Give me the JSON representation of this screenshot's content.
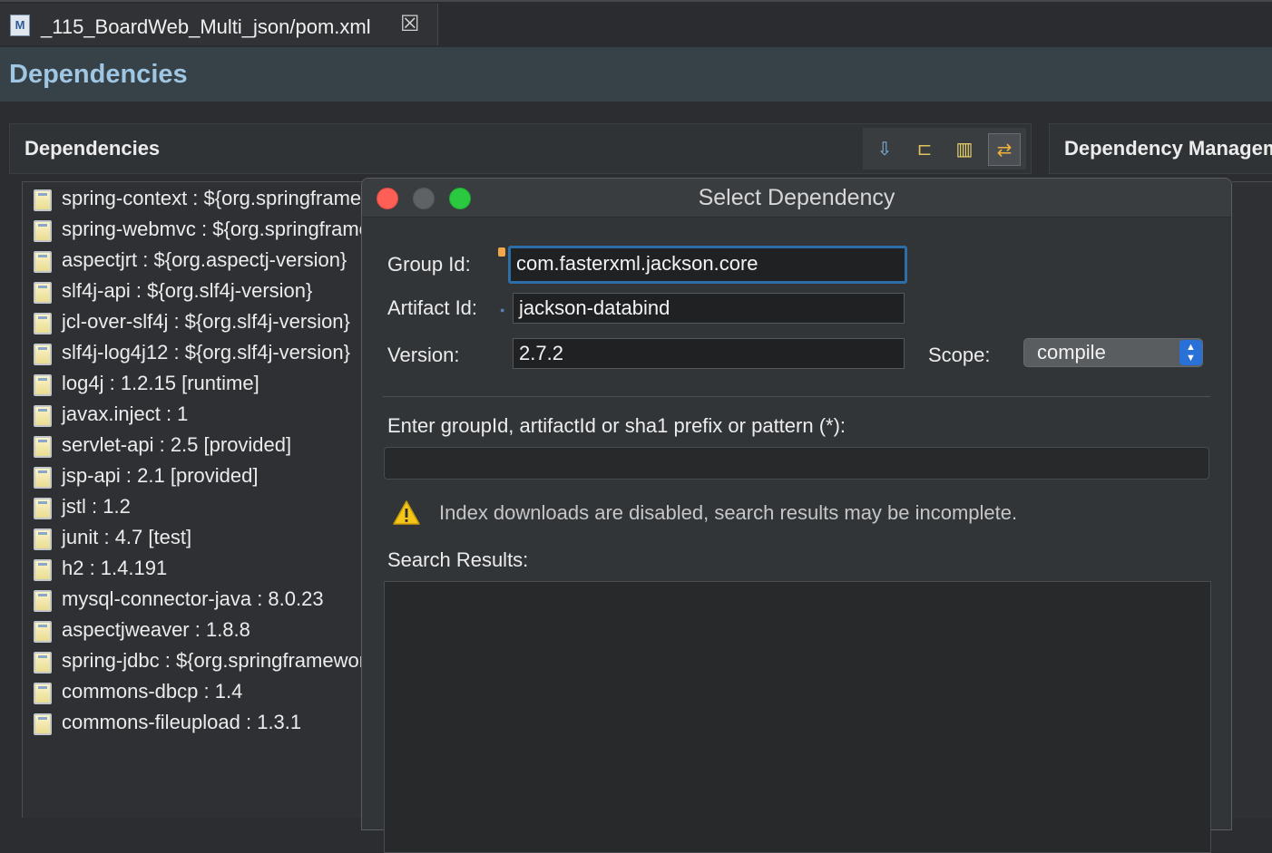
{
  "tab": {
    "title": "_115_BoardWeb_Multi_json/pom.xml",
    "icon": "maven-file-icon",
    "close_icon": "close-icon",
    "close_glyph": "☒"
  },
  "page": {
    "title": "Dependencies"
  },
  "dependencies_section": {
    "title": "Dependencies",
    "toolbar": [
      {
        "icon": "add-dependency-icon",
        "glyph": "⇩"
      },
      {
        "icon": "hierarchy-icon",
        "glyph": "⊏"
      },
      {
        "icon": "columns-icon",
        "glyph": "▥"
      },
      {
        "icon": "sort-icon",
        "glyph": "⇄"
      }
    ],
    "items": [
      {
        "label": "spring-context : ${org.springframework-version}"
      },
      {
        "label": "spring-webmvc : ${org.springframework-version}"
      },
      {
        "label": "aspectjrt : ${org.aspectj-version}"
      },
      {
        "label": "slf4j-api : ${org.slf4j-version}"
      },
      {
        "label": "jcl-over-slf4j : ${org.slf4j-version}"
      },
      {
        "label": "slf4j-log4j12 : ${org.slf4j-version}"
      },
      {
        "label": "log4j : 1.2.15 [runtime]"
      },
      {
        "label": "javax.inject : 1"
      },
      {
        "label": "servlet-api : 2.5 [provided]"
      },
      {
        "label": "jsp-api : 2.1 [provided]"
      },
      {
        "label": "jstl : 1.2"
      },
      {
        "label": "junit : 4.7 [test]"
      },
      {
        "label": "h2 : 1.4.191"
      },
      {
        "label": "mysql-connector-java : 8.0.23"
      },
      {
        "label": "aspectjweaver : 1.8.8"
      },
      {
        "label": "spring-jdbc : ${org.springframework-version}"
      },
      {
        "label": "commons-dbcp : 1.4"
      },
      {
        "label": "commons-fileupload : 1.3.1"
      }
    ]
  },
  "management_section": {
    "title": "Dependency Management"
  },
  "dialog": {
    "title": "Select Dependency",
    "group_label": "Group Id:",
    "group_value": "com.fasterxml.jackson.core",
    "artifact_label": "Artifact Id:",
    "artifact_value": "jackson-databind",
    "version_label": "Version:",
    "version_value": "2.7.2",
    "scope_label": "Scope:",
    "scope_value": "compile",
    "search_prompt": "Enter groupId, artifactId or sha1 prefix or pattern (*):",
    "search_value": "",
    "warning_icon": "warning-icon",
    "warning_text": "Index downloads are disabled, search results may be incomplete.",
    "results_label": "Search Results:"
  },
  "colors": {
    "accent": "#2d6ea6",
    "page_title": "#9fc6e2",
    "close": "#fd5f57",
    "maximize": "#2ac940"
  }
}
